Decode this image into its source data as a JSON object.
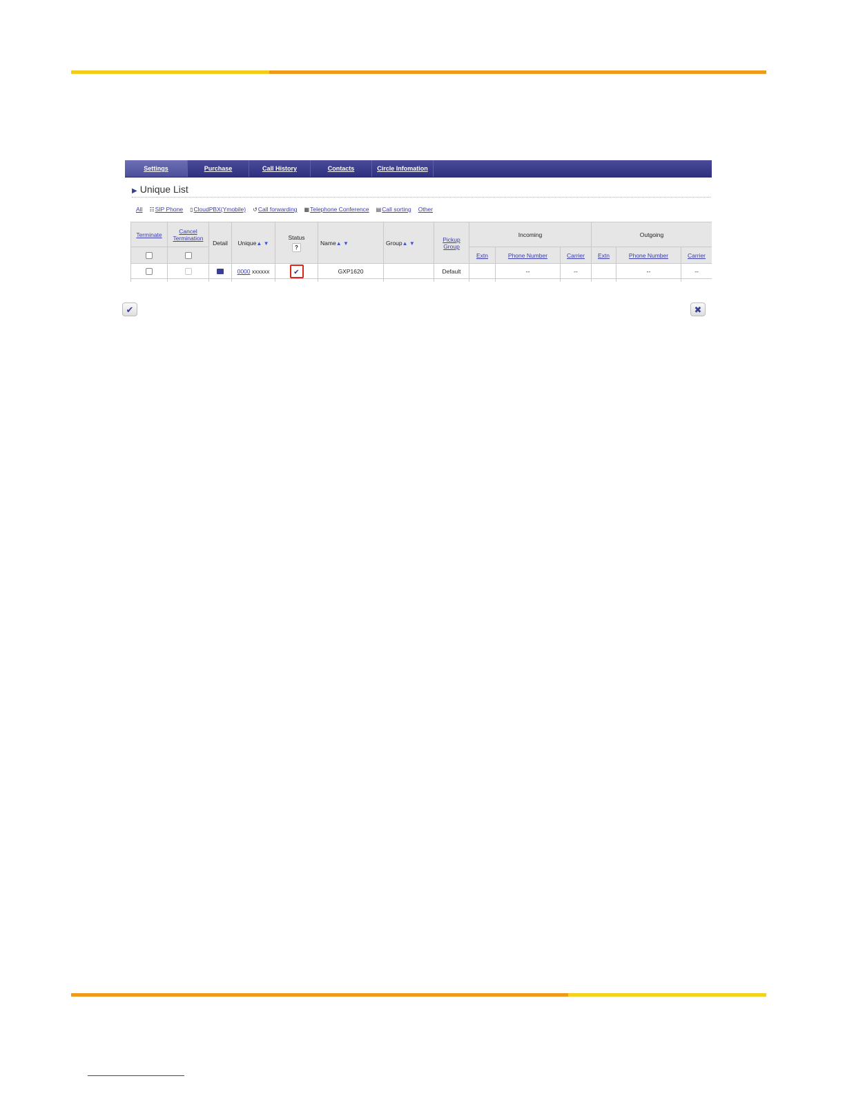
{
  "nav": {
    "tabs": [
      {
        "label": "Settings"
      },
      {
        "label": "Purchase"
      },
      {
        "label": "Call History"
      },
      {
        "label": "Contacts"
      },
      {
        "label": "Circle Infomation"
      }
    ]
  },
  "section": {
    "title": "Unique List"
  },
  "filters": [
    {
      "label": "All",
      "icon": ""
    },
    {
      "label": "SIP Phone",
      "icon": "list-icon"
    },
    {
      "label": "CloudPBX(Ymobile)",
      "icon": "mobile-icon"
    },
    {
      "label": "Call forwarding",
      "icon": "forward-icon"
    },
    {
      "label": "Telephone Conference",
      "icon": "conference-icon"
    },
    {
      "label": "Call sorting",
      "icon": "sorting-icon"
    },
    {
      "label": "Other",
      "icon": ""
    }
  ],
  "table": {
    "headers": {
      "terminate": "Terminate",
      "cancel_termination": "Cancel Termination",
      "detail": "Detail",
      "unique": "Unique",
      "status": "Status",
      "status_help": "?",
      "name": "Name",
      "group": "Group",
      "pickup_group": "Pickup Group",
      "incoming": "Incoming",
      "outgoing": "Outgoing",
      "extn": "Extn",
      "phone_number": "Phone Number",
      "carrier": "Carrier",
      "sort_up": "▲",
      "sort_down": "▼"
    },
    "row": {
      "unique_link": "0000",
      "unique_suffix": "xxxxxx",
      "status_symbol": "✔",
      "name": "GXP1620",
      "group": "",
      "pickup_group": "Default",
      "incoming_extn": "",
      "incoming_phone": "--",
      "incoming_carrier": "--",
      "outgoing_extn": "",
      "outgoing_phone": "--",
      "outgoing_carrier": "--"
    }
  },
  "buttons": {
    "ok_symbol": "✔",
    "close_symbol": "✖"
  },
  "colors": {
    "accent_yellow": "#f2cc1a",
    "accent_orange": "#ef9a1b",
    "nav_blue": "#2f3180",
    "highlight_red": "#d8261b"
  }
}
